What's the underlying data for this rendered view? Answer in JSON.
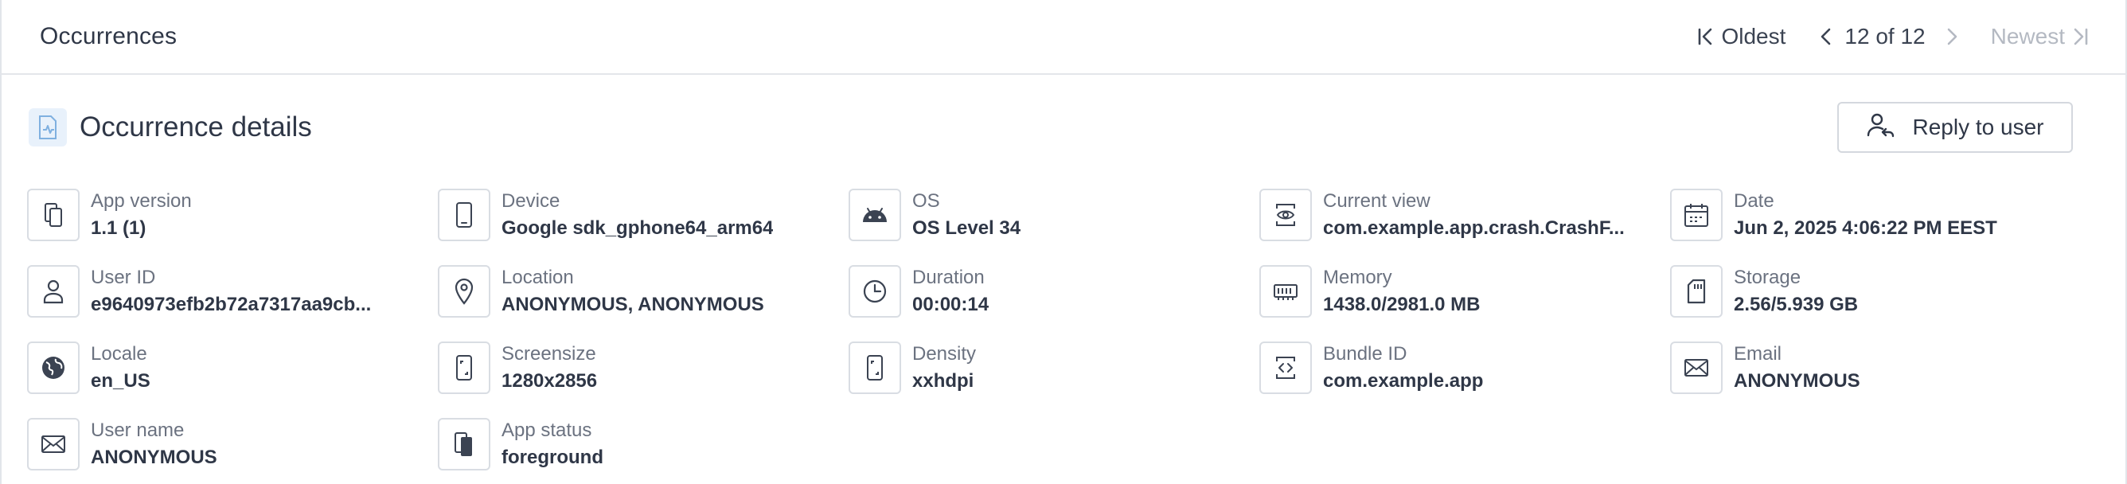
{
  "topbar": {
    "title": "Occurrences",
    "oldest_label": "Oldest",
    "count_label": "12 of 12",
    "newest_label": "Newest"
  },
  "details": {
    "title": "Occurrence details",
    "reply_label": "Reply to user"
  },
  "fields": [
    {
      "label": "App version",
      "value": "1.1 (1)",
      "icon": "app-version-icon"
    },
    {
      "label": "Device",
      "value": "Google sdk_gphone64_arm64",
      "icon": "device-icon"
    },
    {
      "label": "OS",
      "value": "OS Level 34",
      "icon": "android-icon"
    },
    {
      "label": "Current view",
      "value": "com.example.app.crash.CrashF...",
      "icon": "view-icon"
    },
    {
      "label": "Date",
      "value": "Jun 2, 2025 4:06:22 PM EEST",
      "icon": "calendar-icon"
    },
    {
      "label": "User ID",
      "value": "e9640973efb2b72a7317aa9cb...",
      "icon": "user-icon"
    },
    {
      "label": "Location",
      "value": "ANONYMOUS, ANONYMOUS",
      "icon": "location-pin-icon"
    },
    {
      "label": "Duration",
      "value": "00:00:14",
      "icon": "clock-icon"
    },
    {
      "label": "Memory",
      "value": "1438.0/2981.0 MB",
      "icon": "memory-icon"
    },
    {
      "label": "Storage",
      "value": "2.56/5.939 GB",
      "icon": "storage-icon"
    },
    {
      "label": "Locale",
      "value": "en_US",
      "icon": "globe-icon"
    },
    {
      "label": "Screensize",
      "value": "1280x2856",
      "icon": "screensize-icon"
    },
    {
      "label": "Density",
      "value": "xxhdpi",
      "icon": "density-icon"
    },
    {
      "label": "Bundle ID",
      "value": "com.example.app",
      "icon": "bundle-icon"
    },
    {
      "label": "Email",
      "value": "ANONYMOUS",
      "icon": "email-icon"
    },
    {
      "label": "User name",
      "value": "ANONYMOUS",
      "icon": "email-icon"
    },
    {
      "label": "App status",
      "value": "foreground",
      "icon": "app-status-icon"
    }
  ]
}
